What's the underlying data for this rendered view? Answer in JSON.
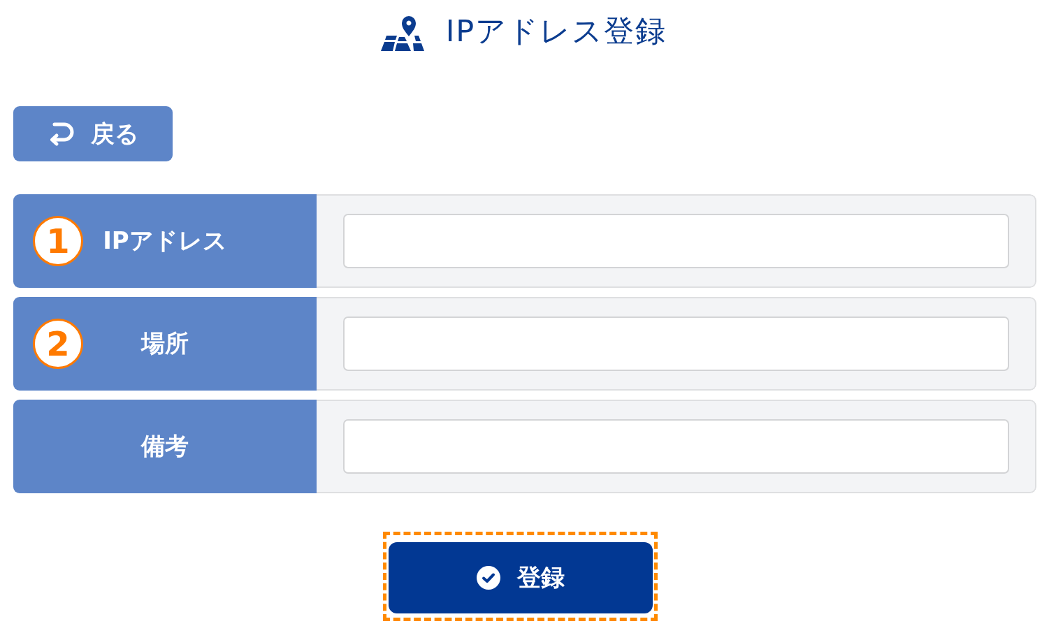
{
  "header": {
    "title": "IPアドレス登録"
  },
  "back_button": {
    "label": "戻る"
  },
  "form": {
    "fields": [
      {
        "label": "IPアドレス",
        "marker": "1"
      },
      {
        "label": "場所",
        "marker": "2"
      },
      {
        "label": "備考"
      }
    ]
  },
  "submit_button": {
    "label": "登録",
    "highlighted": true
  }
}
